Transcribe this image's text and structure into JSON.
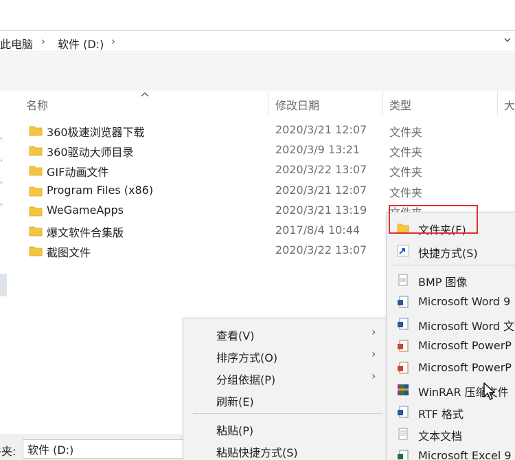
{
  "address": {
    "crumb_pc": "此电脑",
    "sep1": "›",
    "crumb_drive": "软件 (D:)",
    "sep2": "›"
  },
  "columns": {
    "name": "名称",
    "modified": "修改日期",
    "type": "类型",
    "size": "大"
  },
  "files": [
    {
      "name": "360极速浏览器下载",
      "date": "2020/3/21 12:07",
      "type": "文件夹"
    },
    {
      "name": "360驱动大师目录",
      "date": "2020/3/9 13:21",
      "type": "文件夹"
    },
    {
      "name": "GIF动画文件",
      "date": "2020/3/22 13:07",
      "type": "文件夹"
    },
    {
      "name": "Program Files (x86)",
      "date": "2020/3/21 12:07",
      "type": "文件夹"
    },
    {
      "name": "WeGameApps",
      "date": "2020/3/21 13:19",
      "type": "文件夹"
    },
    {
      "name": "爆文软件合集版",
      "date": "2017/8/4 10:44",
      "type": ""
    },
    {
      "name": "截图文件",
      "date": "2020/3/22 13:07",
      "type": ""
    }
  ],
  "context_menu": {
    "view": "查看(V)",
    "sort": "排序方式(O)",
    "group": "分组依据(P)",
    "refresh": "刷新(E)",
    "paste": "粘贴(P)",
    "paste_shortcut": "粘贴快捷方式(S)"
  },
  "submenu": {
    "folder": "文件夹(F)",
    "shortcut": "快捷方式(S)",
    "bmp": "BMP 图像",
    "word1": "Microsoft Word 9",
    "word2": "Microsoft Word 文",
    "ppt1": "Microsoft PowerP",
    "ppt2": "Microsoft PowerP",
    "winrar": "WinRAR 压缩文件",
    "rtf": "RTF 格式",
    "txt": "文本文档",
    "excel": "Microsoft Excel 9"
  },
  "bottom": {
    "label": "牛夹:",
    "filename_value": "软件 (D:)"
  },
  "colors": {
    "folder": "#f5c542",
    "highlight_border": "#e0302a",
    "menu_bg": "#f2f2f2"
  }
}
